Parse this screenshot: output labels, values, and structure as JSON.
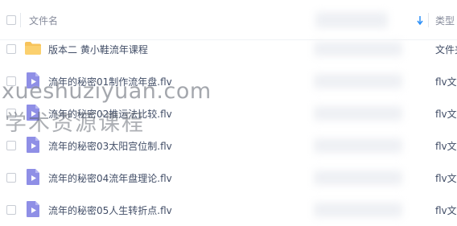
{
  "header": {
    "name_label": "文件名",
    "type_label": "类型"
  },
  "rows": [
    {
      "name": "版本二 黄小鞋流年课程",
      "type": "文件夹",
      "icon": "folder-icon"
    },
    {
      "name": "流年的秘密01制作流年盘.flv",
      "type": "flv文件",
      "icon": "video-file-icon"
    },
    {
      "name": "流年的秘密02推运法比较.flv",
      "type": "flv文件",
      "icon": "video-file-icon"
    },
    {
      "name": "流年的秘密03太阳宫位制.flv",
      "type": "flv文件",
      "icon": "video-file-icon"
    },
    {
      "name": "流年的秘密04流年盘理论.flv",
      "type": "flv文件",
      "icon": "video-file-icon"
    },
    {
      "name": "流年的秘密05人生转折点.flv",
      "type": "flv文件",
      "icon": "video-file-icon"
    }
  ],
  "watermark": {
    "line1": "xueshuziyuan.com",
    "line2": "学术资源课程"
  },
  "colors": {
    "folder": "#f7c35b",
    "video": "#8f8fe6",
    "sort_arrow": "#2b8ff7"
  }
}
